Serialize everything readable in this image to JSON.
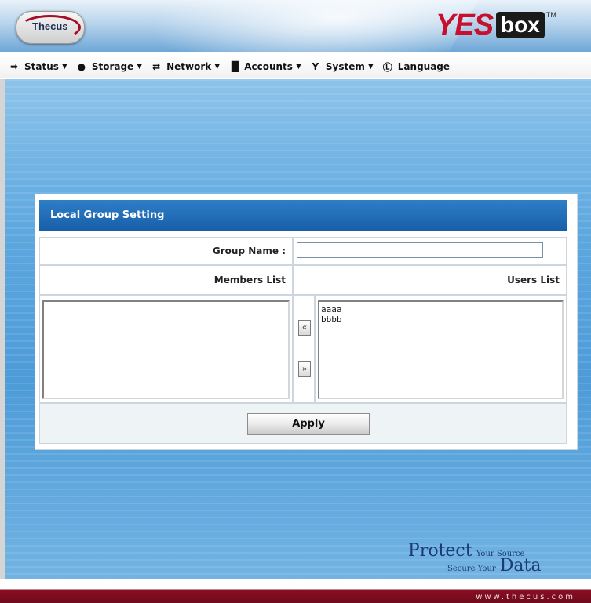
{
  "header": {
    "logo_text": "Thecus",
    "brand_text": "YES",
    "brand_box": "box",
    "brand_tm": "TM"
  },
  "menu": {
    "items": [
      {
        "label": "Status",
        "icon": "status-icon"
      },
      {
        "label": "Storage",
        "icon": "storage-icon"
      },
      {
        "label": "Network",
        "icon": "network-icon"
      },
      {
        "label": "Accounts",
        "icon": "accounts-icon"
      },
      {
        "label": "System",
        "icon": "system-icon"
      },
      {
        "label": "Language",
        "icon": "language-icon"
      }
    ]
  },
  "panel": {
    "title": "Local Group Setting",
    "group_name_label": "Group Name :",
    "group_name_value": "",
    "members_list_label": "Members List",
    "users_list_label": "Users List",
    "members": [],
    "users": [
      "aaaa",
      "bbbb"
    ],
    "move_left_label": "«",
    "move_right_label": "»",
    "apply_label": "Apply"
  },
  "branding": {
    "protect": "Protect",
    "your_source": "Your Source",
    "secure_your": "Secure Your",
    "data": "Data",
    "url": "www.thecus.com"
  },
  "colors": {
    "panel_title_bg": "#1f6db8",
    "footer_bar": "#7d0c20",
    "brand_red": "#c8102e"
  }
}
